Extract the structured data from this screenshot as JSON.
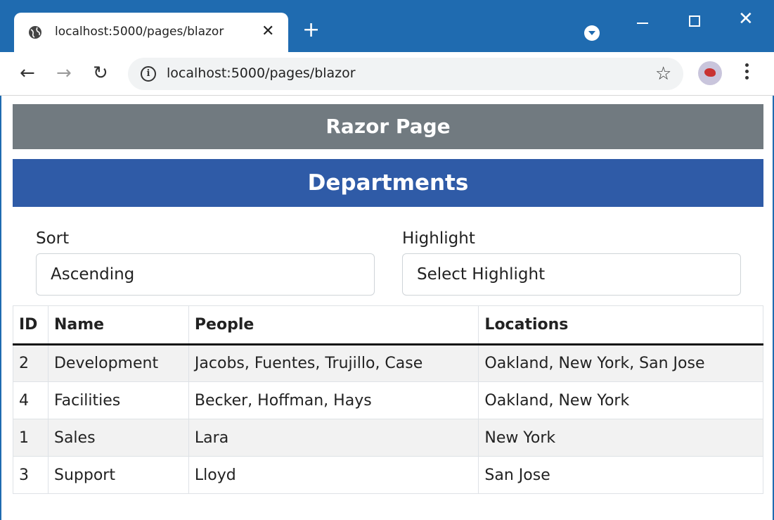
{
  "browser": {
    "tab_title": "localhost:5000/pages/blazor",
    "url": "localhost:5000/pages/blazor"
  },
  "page": {
    "header": "Razor Page",
    "title": "Departments"
  },
  "controls": {
    "sort_label": "Sort",
    "sort_value": "Ascending",
    "highlight_label": "Highlight",
    "highlight_value": "Select Highlight"
  },
  "table": {
    "headers": [
      "ID",
      "Name",
      "People",
      "Locations"
    ],
    "rows": [
      [
        "2",
        "Development",
        "Jacobs, Fuentes, Trujillo, Case",
        "Oakland, New York, San Jose"
      ],
      [
        "4",
        "Facilities",
        "Becker, Hoffman, Hays",
        "Oakland, New York"
      ],
      [
        "1",
        "Sales",
        "Lara",
        "New York"
      ],
      [
        "3",
        "Support",
        "Lloyd",
        "San Jose"
      ]
    ]
  },
  "colors": {
    "titlebar": "#1f6bb0",
    "razor_bar": "#717a80",
    "dept_bar": "#2f5ba7",
    "stripe": "#f2f2f2"
  }
}
